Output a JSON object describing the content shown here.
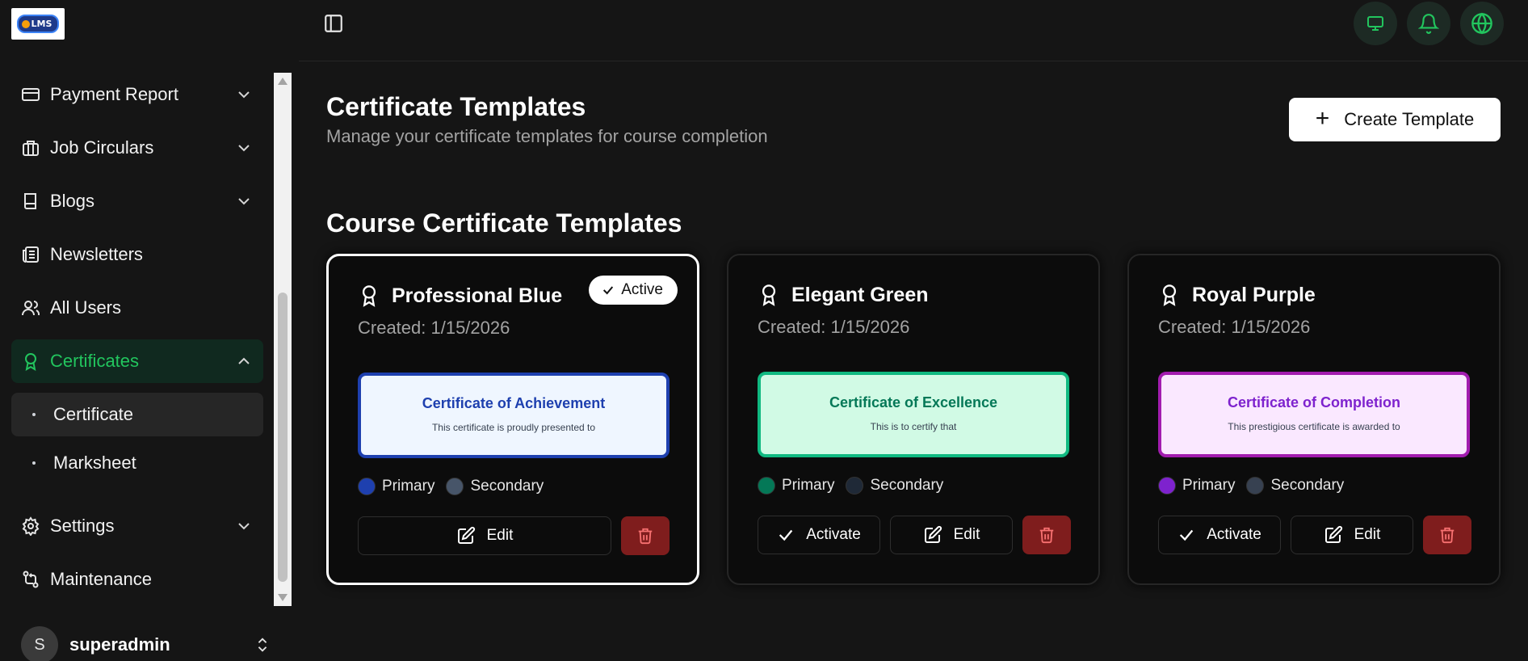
{
  "app": {
    "logo_text": "LMS"
  },
  "sidebar": {
    "items": [
      {
        "label": "Payment Report",
        "icon": "credit-card-icon"
      },
      {
        "label": "Job Circulars",
        "icon": "briefcase-icon"
      },
      {
        "label": "Blogs",
        "icon": "book-icon"
      },
      {
        "label": "Newsletters",
        "icon": "newspaper-icon"
      },
      {
        "label": "All Users",
        "icon": "users-icon"
      },
      {
        "label": "Certificates",
        "icon": "award-icon"
      },
      {
        "label": "Settings",
        "icon": "gear-icon"
      },
      {
        "label": "Maintenance",
        "icon": "workflow-icon"
      }
    ],
    "sub_items": [
      {
        "label": "Certificate"
      },
      {
        "label": "Marksheet"
      }
    ],
    "user": {
      "initial": "S",
      "name": "superadmin"
    }
  },
  "header": {
    "title": "Certificate Templates",
    "subtitle": "Manage your certificate templates for course completion",
    "create_label": "Create Template",
    "section_title": "Course Certificate Templates"
  },
  "templates": [
    {
      "name": "Professional Blue",
      "created": "Created: 1/15/2026",
      "status": "Active",
      "preview_title": "Certificate of Achievement",
      "preview_text": "This certificate is proudly presented to",
      "primary_label": "Primary",
      "secondary_label": "Secondary",
      "primary_color": "#1e40af",
      "secondary_color": "#475569",
      "preview_bg": "#eff6ff",
      "edit_label": "Edit"
    },
    {
      "name": "Elegant Green",
      "created": "Created: 1/15/2026",
      "preview_title": "Certificate of Excellence",
      "preview_text": "This is to certify that",
      "primary_label": "Primary",
      "secondary_label": "Secondary",
      "primary_color": "#047857",
      "secondary_color": "#1f2937",
      "preview_bg": "#d1fae5",
      "activate_label": "Activate",
      "edit_label": "Edit"
    },
    {
      "name": "Royal Purple",
      "created": "Created: 1/15/2026",
      "preview_title": "Certificate of Completion",
      "preview_text": "This prestigious certificate is awarded to",
      "primary_label": "Primary",
      "secondary_label": "Secondary",
      "primary_color": "#7e22ce",
      "secondary_color": "#374151",
      "preview_bg": "#fae8ff",
      "activate_label": "Activate",
      "edit_label": "Edit"
    }
  ],
  "colors": {
    "accent_green": "#22c55e",
    "active_bg": "#10291f",
    "delete_red": "#7f1d1d",
    "delete_icon": "#f87171"
  }
}
